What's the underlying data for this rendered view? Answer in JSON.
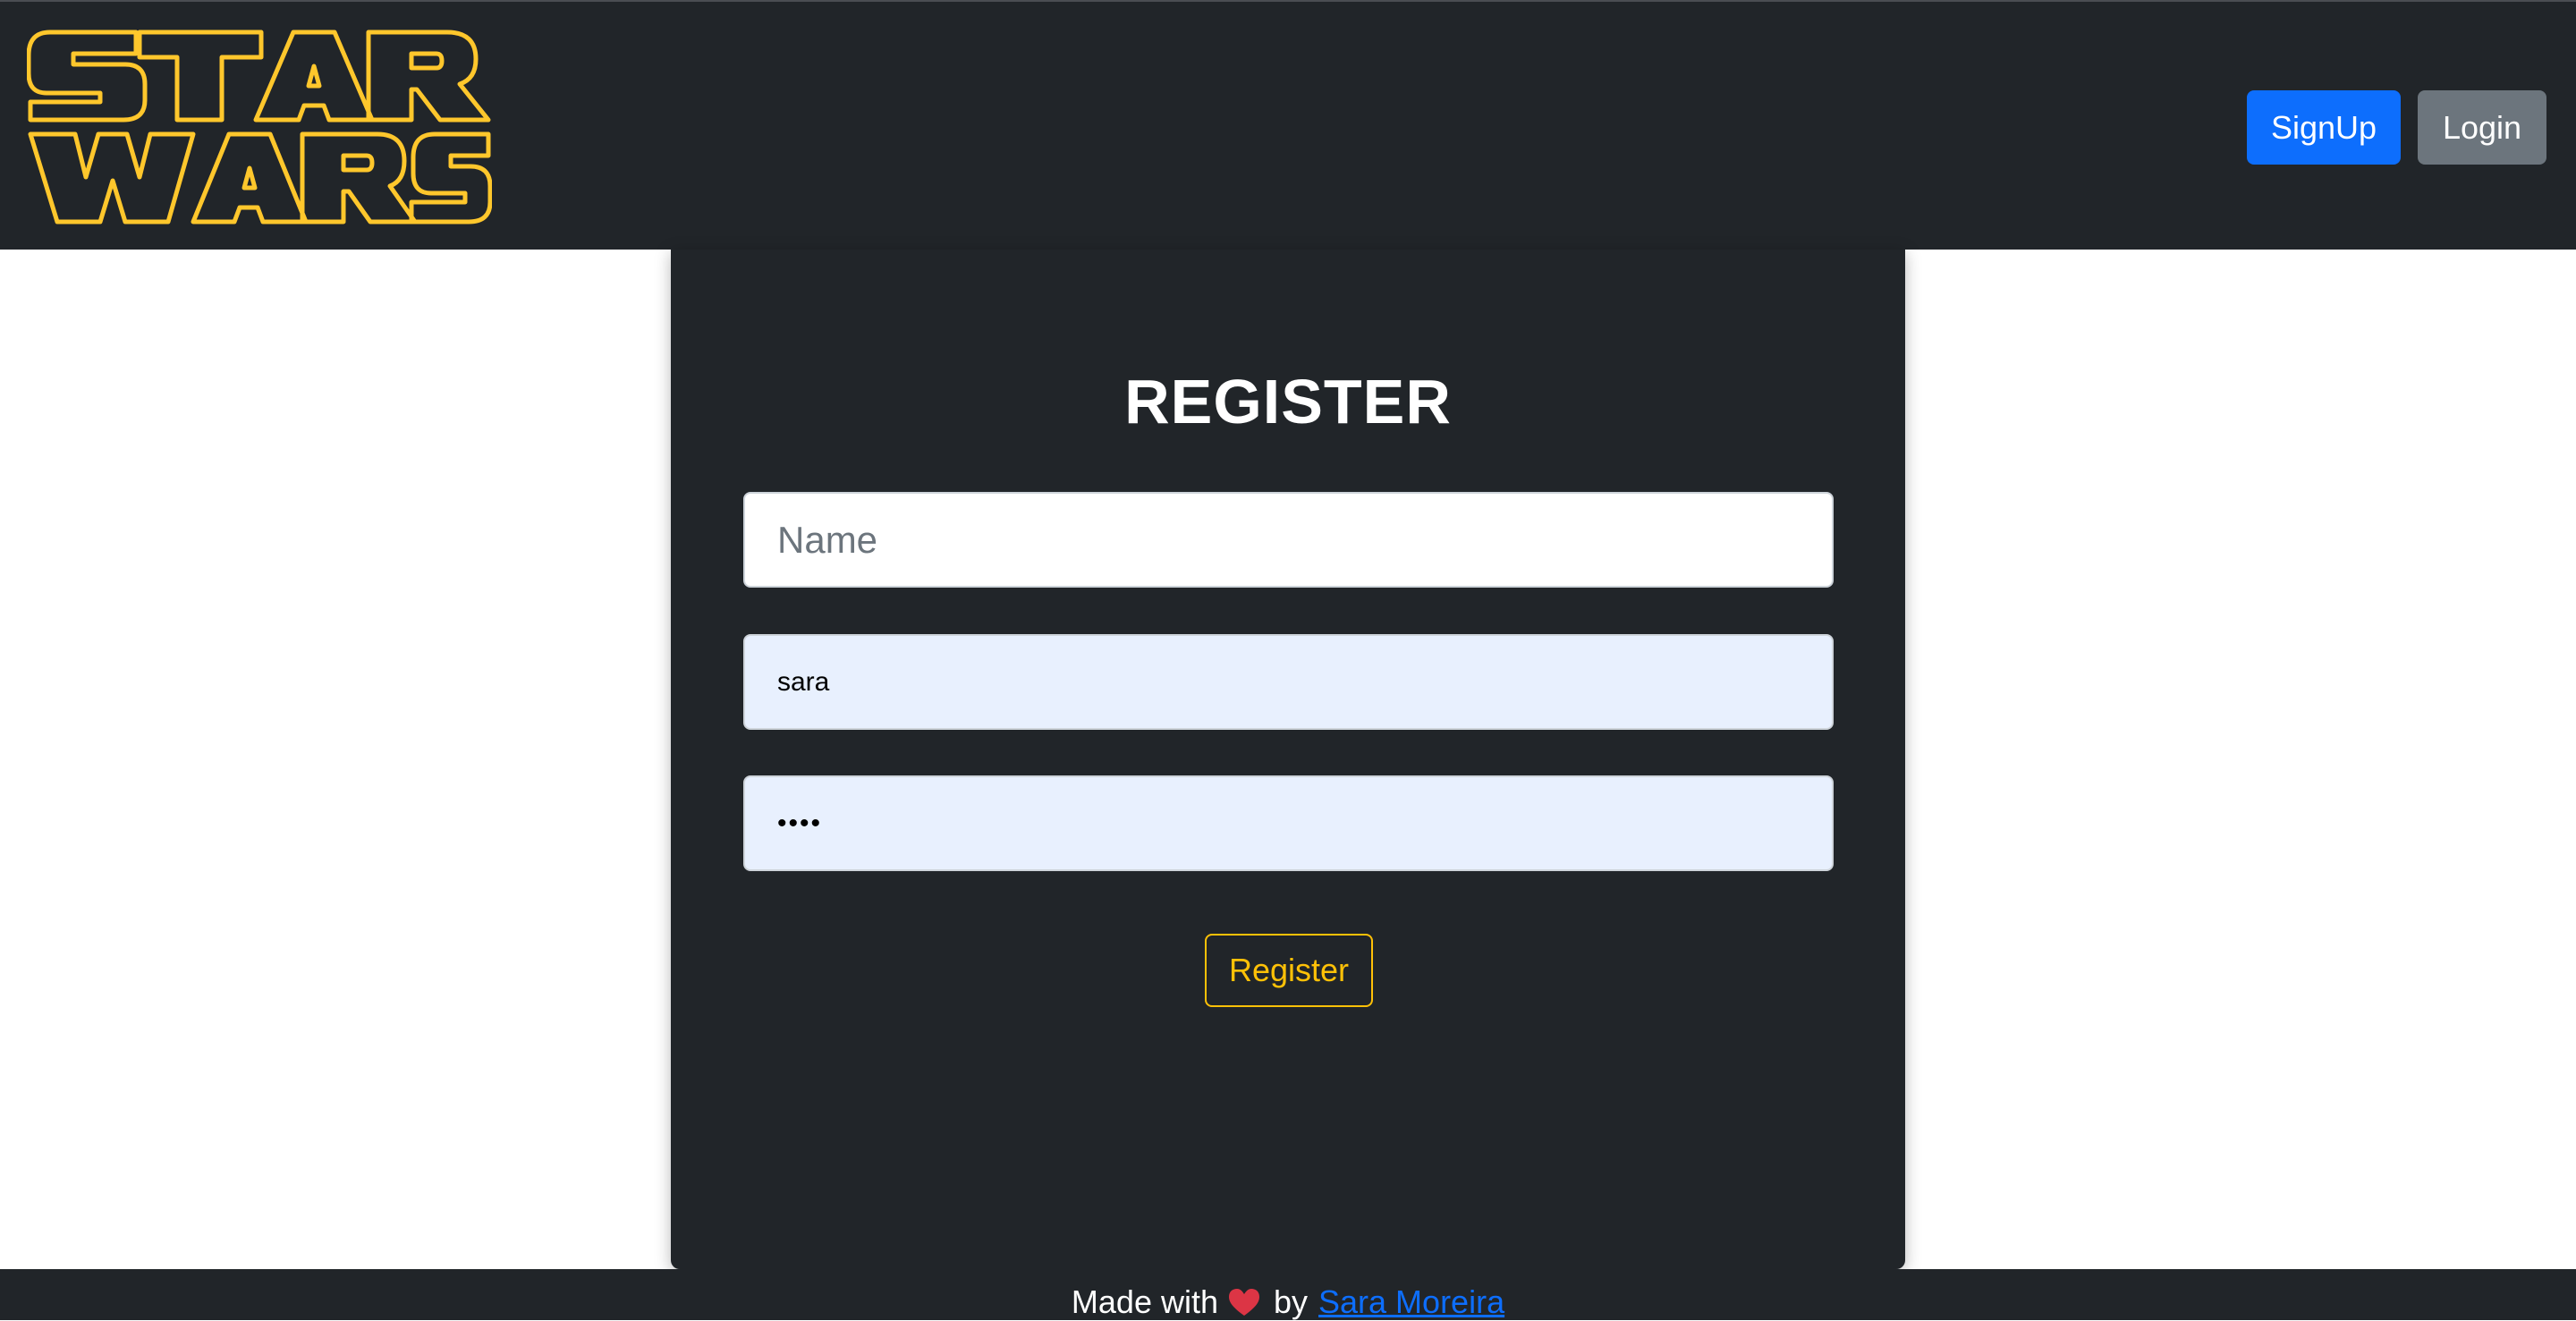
{
  "header": {
    "logo": {
      "text": "STAR WARS",
      "line1": "STAR",
      "line2": "WARS",
      "color": "#ffc72c"
    },
    "signup_label": "SignUp",
    "login_label": "Login"
  },
  "form": {
    "title": "REGISTER",
    "name_placeholder": "Name",
    "username_value": "sara",
    "password_value": "••••",
    "submit_label": "Register"
  },
  "footer": {
    "prefix": "Made with",
    "icon": "heart-icon",
    "by": "by",
    "author": "Sara Moreira"
  },
  "colors": {
    "nav_bg": "#212529",
    "primary": "#0d6efd",
    "secondary": "#6c757d",
    "warning": "#ffc107",
    "autofill_bg": "#e8f0fe",
    "heart": "#dc3545"
  }
}
